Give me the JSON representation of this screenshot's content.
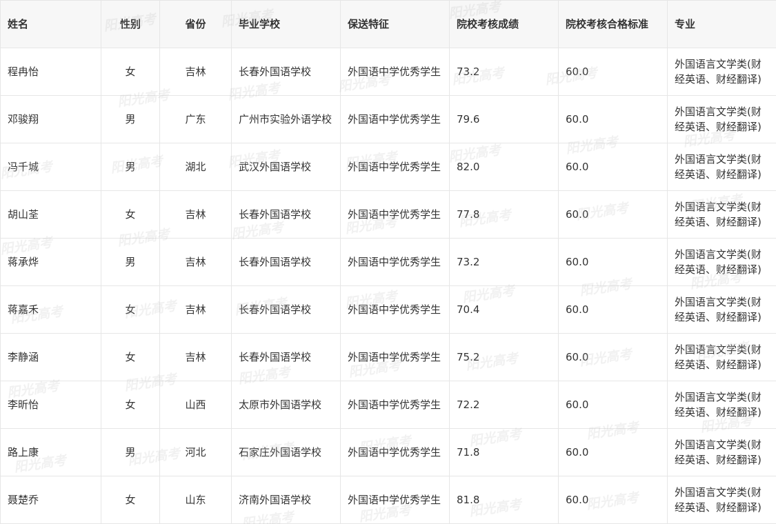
{
  "watermark": {
    "text": "阳光高考"
  },
  "table": {
    "headers": [
      "姓名",
      "性别",
      "省份",
      "毕业学校",
      "保送特征",
      "院校考核成绩",
      "院校考核合格标准",
      "专业"
    ],
    "rows": [
      [
        "程冉怡",
        "女",
        "吉林",
        "长春外国语学校",
        "外国语中学优秀学生",
        "73.2",
        "60.0",
        "外国语言文学类(财经英语、财经翻译)"
      ],
      [
        "邓骏翔",
        "男",
        "广东",
        "广州市实验外语学校",
        "外国语中学优秀学生",
        "79.6",
        "60.0",
        "外国语言文学类(财经英语、财经翻译)"
      ],
      [
        "冯千城",
        "男",
        "湖北",
        "武汉外国语学校",
        "外国语中学优秀学生",
        "82.0",
        "60.0",
        "外国语言文学类(财经英语、财经翻译)"
      ],
      [
        "胡山荃",
        "女",
        "吉林",
        "长春外国语学校",
        "外国语中学优秀学生",
        "77.8",
        "60.0",
        "外国语言文学类(财经英语、财经翻译)"
      ],
      [
        "蒋承烨",
        "男",
        "吉林",
        "长春外国语学校",
        "外国语中学优秀学生",
        "73.2",
        "60.0",
        "外国语言文学类(财经英语、财经翻译)"
      ],
      [
        "蒋嘉禾",
        "女",
        "吉林",
        "长春外国语学校",
        "外国语中学优秀学生",
        "70.4",
        "60.0",
        "外国语言文学类(财经英语、财经翻译)"
      ],
      [
        "李静涵",
        "女",
        "吉林",
        "长春外国语学校",
        "外国语中学优秀学生",
        "75.2",
        "60.0",
        "外国语言文学类(财经英语、财经翻译)"
      ],
      [
        "李昕怡",
        "女",
        "山西",
        "太原市外国语学校",
        "外国语中学优秀学生",
        "72.2",
        "60.0",
        "外国语言文学类(财经英语、财经翻译)"
      ],
      [
        "路上康",
        "男",
        "河北",
        "石家庄外国语学校",
        "外国语中学优秀学生",
        "71.8",
        "60.0",
        "外国语言文学类(财经英语、财经翻译)"
      ],
      [
        "聂楚乔",
        "女",
        "山东",
        "济南外国语学校",
        "外国语中学优秀学生",
        "81.8",
        "60.0",
        "外国语言文学类(财经英语、财经翻译)"
      ]
    ]
  }
}
